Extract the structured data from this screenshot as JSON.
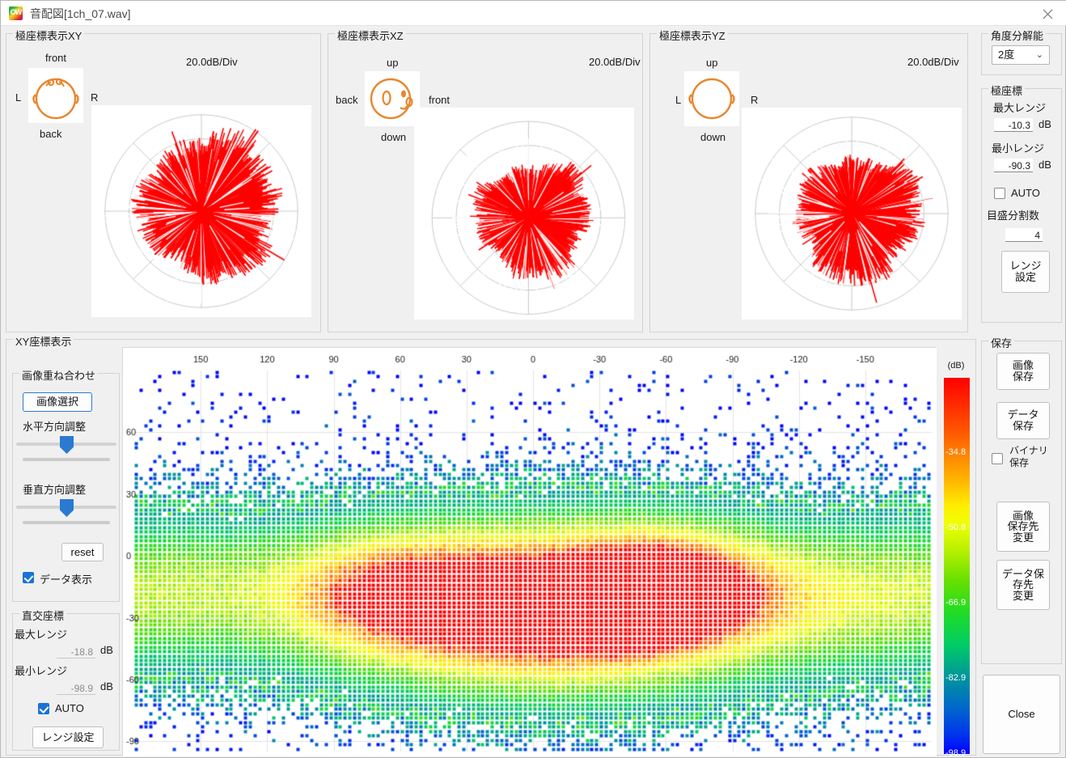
{
  "window": {
    "title": "音配図[1ch_07.wav]",
    "icon": "app-logo-icon",
    "close_icon": "close-icon"
  },
  "polar_panels": [
    {
      "legend": "極座標表示XY",
      "db_div": "20.0dB/Div",
      "top_label": "front",
      "bottom_label": "back",
      "left_label": "L",
      "right_label": "R",
      "head_icon": "head-top-view-icon"
    },
    {
      "legend": "極座標表示XZ",
      "db_div": "20.0dB/Div",
      "top_label": "up",
      "bottom_label": "down",
      "left_label": "back",
      "right_label": "front",
      "head_icon": "head-side-view-icon"
    },
    {
      "legend": "極座標表示YZ",
      "db_div": "20.0dB/Div",
      "top_label": "up",
      "bottom_label": "down",
      "left_label": "L",
      "right_label": "R",
      "head_icon": "head-front-view-icon"
    }
  ],
  "angle_resolution": {
    "legend": "角度分解能",
    "value": "2度",
    "chevron": "⌄"
  },
  "polar_range": {
    "legend": "極座標",
    "max_label": "最大レンジ",
    "max_value": "-10.3",
    "max_unit": "dB",
    "min_label": "最小レンジ",
    "min_value": "-90.3",
    "min_unit": "dB",
    "auto_label": "AUTO",
    "auto_checked": false,
    "divisions_label": "目盛分割数",
    "divisions_value": "4",
    "range_button": "レンジ\n設定"
  },
  "save_panel": {
    "legend": "保存",
    "save_image_button": "画像\n保存",
    "save_data_button": "データ\n保存",
    "binary_label": "バイナリ\n保存",
    "binary_checked": false,
    "change_image_dest_button": "画像\n保存先\n変更",
    "change_data_dest_button": "データ保\n存先\n変更",
    "close_button": "Close"
  },
  "xy_panel": {
    "legend": "XY座標表示"
  },
  "overlay_panel": {
    "legend": "画像重ね合わせ",
    "select_image_button": "画像選択",
    "horizontal_label": "水平方向調整",
    "vertical_label": "垂直方向調整",
    "reset_button": "reset",
    "data_display_label": "データ表示",
    "data_display_checked": true
  },
  "cartesian_range": {
    "legend": "直交座標",
    "max_label": "最大レンジ",
    "max_value": "-18.8",
    "max_unit": "dB",
    "min_label": "最小レンジ",
    "min_value": "-98.9",
    "min_unit": "dB",
    "auto_label": "AUTO",
    "auto_checked": true,
    "range_button": "レンジ設定"
  },
  "chart_data": {
    "type": "heatmap",
    "title": "XY座標表示",
    "xlabel": "",
    "ylabel": "",
    "colorbar_label": "(dB)",
    "x_ticks": [
      "150",
      "120",
      "90",
      "60",
      "30",
      "0",
      "-30",
      "-60",
      "-90",
      "-120",
      "-150"
    ],
    "x_tick_values": [
      150,
      120,
      90,
      60,
      30,
      0,
      -30,
      -60,
      -90,
      -120,
      -150
    ],
    "xlim": [
      180,
      -180
    ],
    "y_ticks": [
      "60",
      "30",
      "0",
      "-30",
      "-60",
      "-90"
    ],
    "y_tick_values": [
      60,
      30,
      0,
      -30,
      -60,
      -90
    ],
    "ylim": [
      90,
      -95
    ],
    "colorbar_ticks": [
      "-34.8",
      "-50.8",
      "-66.9",
      "-82.9",
      "-98.9"
    ],
    "colorbar_tick_values": [
      -34.8,
      -50.8,
      -66.9,
      -82.9,
      -98.9
    ],
    "zlim": [
      -18.8,
      -98.9
    ],
    "grid": true,
    "colormap": "jet",
    "description": "Sound-intensity distribution over azimuth (x, degrees) and elevation (y, degrees). Peak energy ~-30 dB near azimuth 0 to -10, elevation -25; second lobe near azimuth -60. Values fall off toward edges into blue/green noise floor near -99 dB."
  },
  "polar_data": {
    "type": "polar",
    "series_color": "#ff0000",
    "grid_color": "#c8c8c8",
    "rings": 4,
    "spokes": 8,
    "db_per_div": 20.0
  }
}
